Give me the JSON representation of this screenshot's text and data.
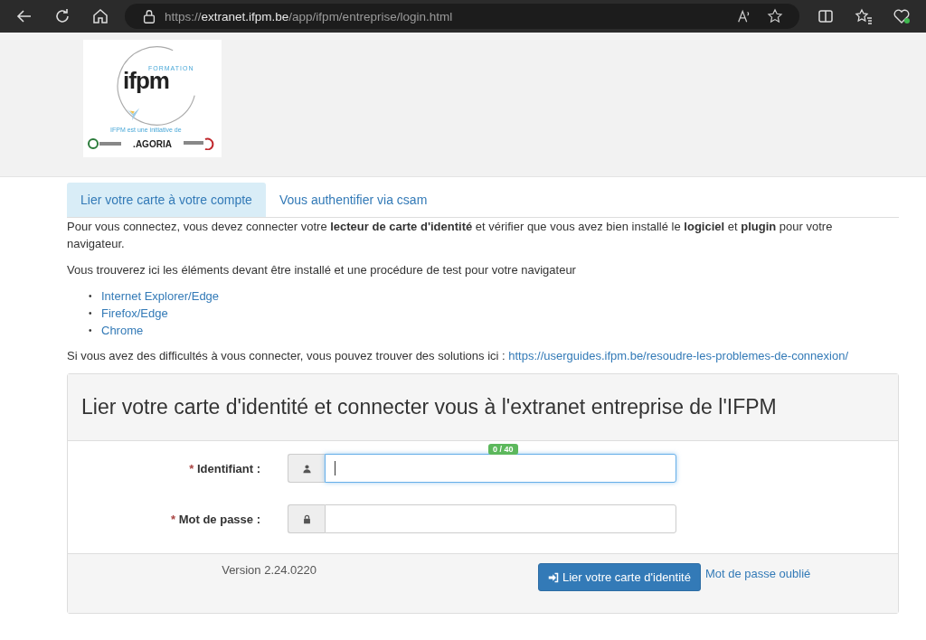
{
  "browser": {
    "url_prefix": "https://",
    "url_host": "extranet.ifpm.be",
    "url_path": "/app/ifpm/entreprise/login.html"
  },
  "logo": {
    "wordmark": "ifpm",
    "tagline": "FORMATION",
    "caption": "IFPM est une initiative de",
    "partner": ".AGORIA"
  },
  "tabs": [
    {
      "label": "Lier votre carte à votre compte",
      "selected": true
    },
    {
      "label": "Vous authentifier via csam",
      "selected": false
    }
  ],
  "intro": "Pour vous connectez, vous devez connecter votre **lecteur de carte d'identité** et vérifier que vous avez bien installé le **logiciel** et **plugin** pour votre navigateur.",
  "install_text": "Vous trouverez ici les éléments devant être installé et une procédure de test pour votre navigateur",
  "browser_links": [
    {
      "marker": "•",
      "label": "Internet Explorer/Edge"
    },
    {
      "marker": "•",
      "label": "Firefox/Edge"
    },
    {
      "marker": "•",
      "label": "Chrome"
    }
  ],
  "help": {
    "text": "Si vous avez des difficultés à vous connecter, vous pouvez trouver des solutions ici :",
    "link": "https://userguides.ifpm.be/resoudre-les-problemes-de-connexion/"
  },
  "panel": {
    "title": "Lier votre carte d'identité et connecter vous à l'extranet entreprise de l'IFPM",
    "fields": [
      {
        "kind": "user",
        "required_mark": "*",
        "label": "Identifiant :",
        "counter": "0 / 40",
        "focused": true
      },
      {
        "kind": "lock",
        "required_mark": "*",
        "label": "Mot de passe :",
        "focused": false
      }
    ],
    "version": "Version 2.24.0220",
    "submit": "Lier votre carte d'identité",
    "forgot": "Mot de passe oublié"
  }
}
